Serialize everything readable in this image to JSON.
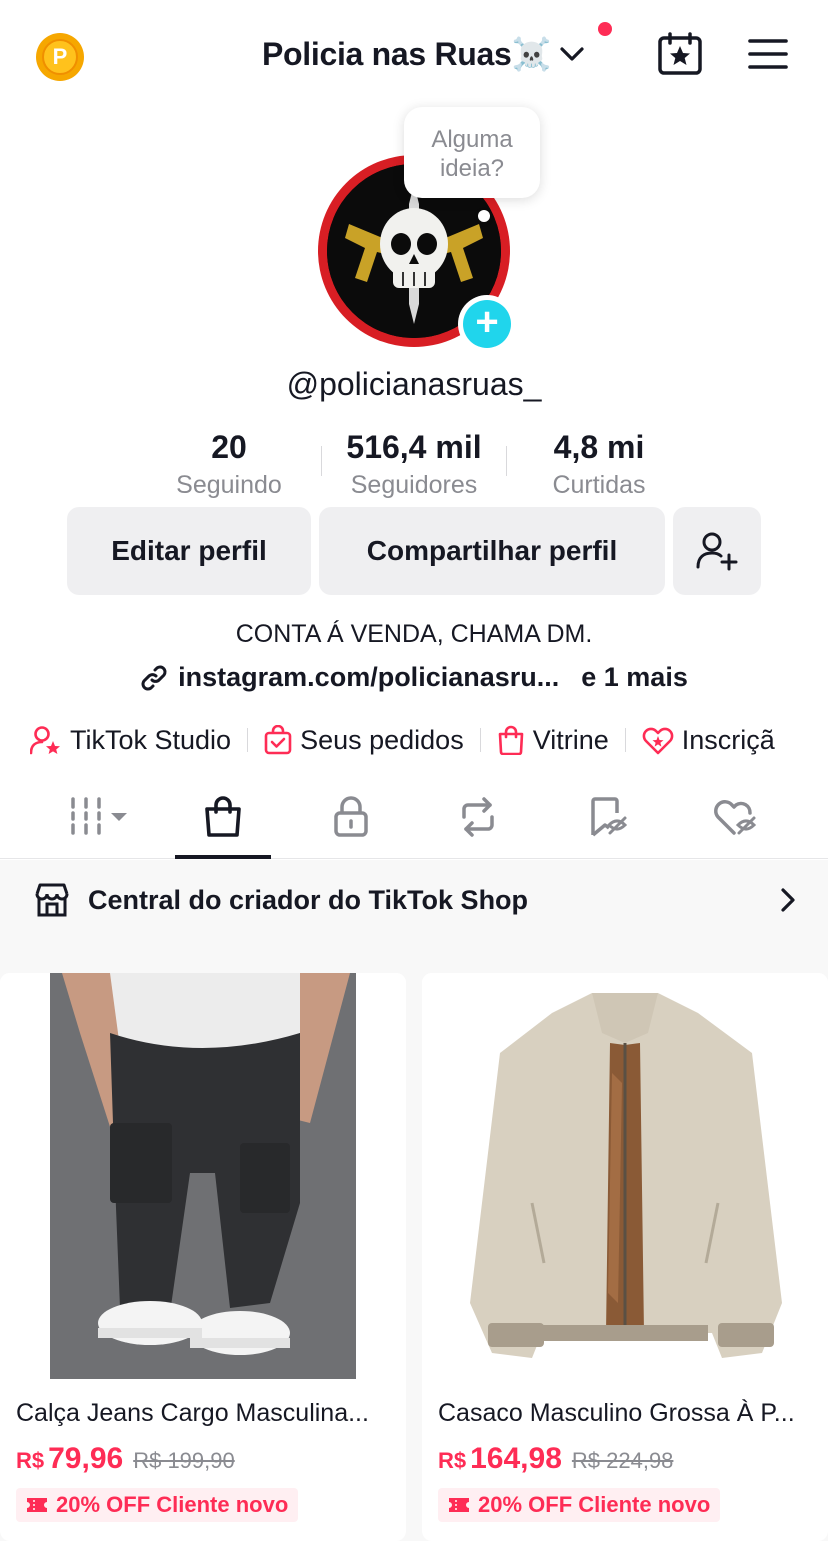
{
  "header": {
    "title": "Policia nas Ruas☠️",
    "coin_icon": "coin-p-icon",
    "coin_letter": "P"
  },
  "profile": {
    "bubble_text": "Alguma ideia?",
    "handle": "@policianasruas_",
    "stats": [
      {
        "value": "20",
        "label": "Seguindo"
      },
      {
        "value": "516,4 mil",
        "label": "Seguidores"
      },
      {
        "value": "4,8 mi",
        "label": "Curtidas"
      }
    ],
    "buttons": {
      "edit": "Editar perfil",
      "share": "Compartilhar perfil"
    },
    "bio": "CONTA Á VENDA, CHAMA DM.",
    "link_text": "instagram.com/policianasru...",
    "link_more": "e 1 mais"
  },
  "shortcuts": [
    {
      "label": "TikTok Studio",
      "icon": "person-star-icon"
    },
    {
      "label": "Seus pedidos",
      "icon": "bag-check-icon"
    },
    {
      "label": "Vitrine",
      "icon": "shopping-bag-icon"
    },
    {
      "label": "Inscriçã",
      "icon": "heart-star-icon"
    }
  ],
  "creator_center": {
    "label": "Central do criador do TikTok Shop"
  },
  "products": [
    {
      "title": "Calça Jeans Cargo Masculina...",
      "currency": "R$",
      "price": "79,96",
      "old_price": "R$ 199,90",
      "promo": "20% OFF Cliente novo"
    },
    {
      "title": "Casaco Masculino Grossa À P...",
      "currency": "R$",
      "price": "164,98",
      "old_price": "R$ 224,98",
      "promo": "20% OFF Cliente novo"
    }
  ],
  "colors": {
    "accent": "#FE2C55",
    "cyan": "#20D5EC",
    "text": "#161823",
    "muted": "#8A8B91"
  }
}
